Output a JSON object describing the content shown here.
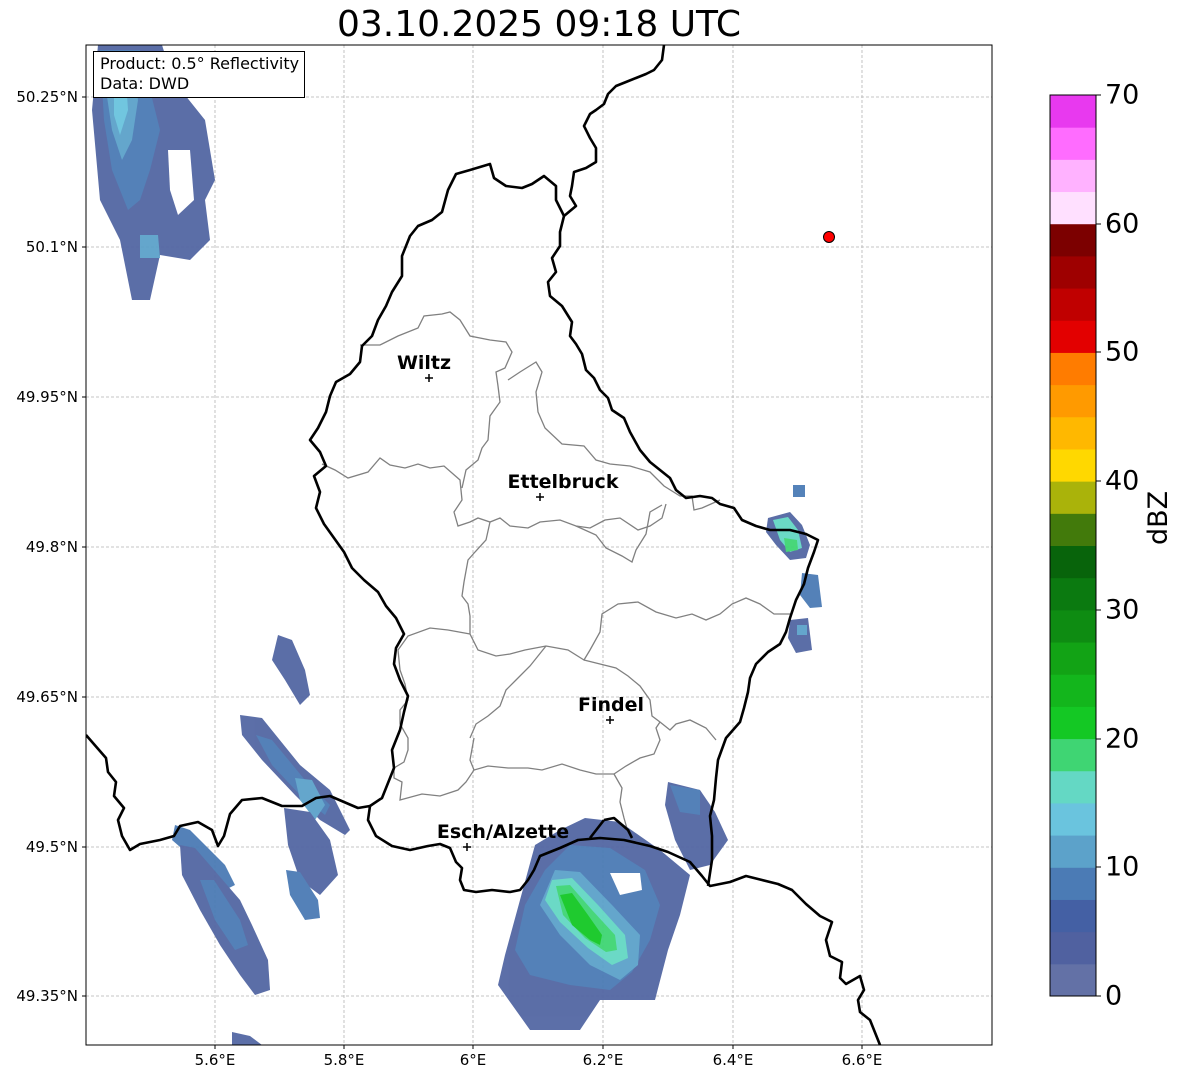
{
  "title": "03.10.2025 09:18 UTC",
  "info_box": {
    "product": "Product: 0.5° Reflectivity",
    "source": "Data: DWD"
  },
  "lat_ticks": [
    "50.25°N",
    "50.1°N",
    "49.95°N",
    "49.8°N",
    "49.65°N",
    "49.5°N",
    "49.35°N"
  ],
  "lon_ticks": [
    "5.6°E",
    "5.8°E",
    "6°E",
    "6.2°E",
    "6.4°E",
    "6.6°E"
  ],
  "cities": [
    {
      "name": "Wiltz"
    },
    {
      "name": "Ettelbruck"
    },
    {
      "name": "Findel"
    },
    {
      "name": "Esch/Alzette"
    }
  ],
  "colorbar": {
    "label": "dBZ",
    "ticks": [
      "0",
      "10",
      "20",
      "30",
      "40",
      "50",
      "60",
      "70"
    ],
    "colors": [
      "#6371a6",
      "#5061a0",
      "#4460a4",
      "#4b7bb5",
      "#5ca2ca",
      "#6ac4de",
      "#64d8c4",
      "#3fd573",
      "#14c824",
      "#13b61c",
      "#12a315",
      "#0e8c12",
      "#0b7a10",
      "#08640b",
      "#427a0b",
      "#aab30a",
      "#ffd800",
      "#ffb800",
      "#ff9a00",
      "#ff7c00",
      "#e30000",
      "#c00000",
      "#9e0000",
      "#7c0000",
      "#ffe0ff",
      "#ffb2ff",
      "#ff6cff",
      "#e839ef"
    ]
  },
  "colors": {
    "border": "#000000",
    "district": "#808080",
    "grid": "#b4b4b4",
    "marker": "#ff0000"
  }
}
